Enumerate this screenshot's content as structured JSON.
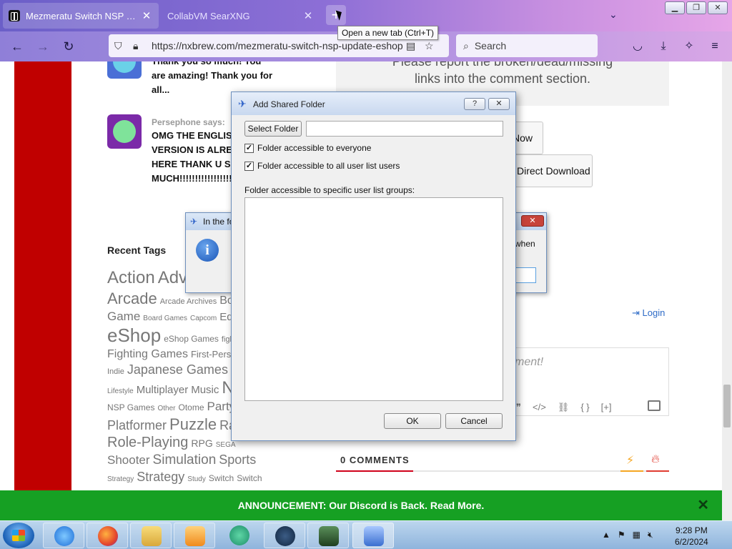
{
  "browser": {
    "tabs": [
      {
        "title": "Mezmeratu Switch NSP + Update",
        "active": true
      },
      {
        "title": "CollabVM SearXNG",
        "active": false
      }
    ],
    "new_tab_tooltip": "Open a new tab (Ctrl+T)",
    "url": "https://nxbrew.com/mezmeratu-switch-nsp-update-eshop",
    "search_placeholder": "Search"
  },
  "page": {
    "comments": [
      {
        "author": "",
        "text": "Thank you so much! You are amazing! Thank you for all..."
      },
      {
        "author": "Persephone says:",
        "text": "OMG THE ENGLISH VERSION IS ALREADY HERE THANK U SOOO MUCH!!!!!!!!!!!!!!!!!!!!!!!!!!!!!!..."
      }
    ],
    "report_text": "Please report the broken/dead/missing links into the comment section.",
    "download_now_label": "Now",
    "direct_download_label": "Direct Download",
    "recent_tags_title": "Recent Tags",
    "tag_lines": [
      [
        "Action",
        "Adv"
      ],
      [
        "Arcade",
        "Arcade Archives",
        "Boa"
      ],
      [
        "Game",
        "Board Games",
        "Capcom",
        "Educ"
      ],
      [
        "eShop",
        "eShop Games",
        "fightin"
      ],
      [
        "Fighting Games",
        "First-Person"
      ],
      [
        "Indie",
        "Japanese Games"
      ],
      [
        "Lifestyle",
        "Multiplayer",
        "Music",
        "N"
      ],
      [
        "NSP Games",
        "Other",
        "Otome",
        "Party"
      ],
      [
        "Platformer",
        "Puzzle",
        "Ra"
      ],
      [
        "Role-Playing",
        "RPG",
        "SEGA"
      ],
      [
        "Shooter",
        "Simulation",
        "Sports"
      ],
      [
        "Strategy",
        "Strategy",
        "Study",
        "Switch",
        "Switch"
      ]
    ],
    "login_label": "Login",
    "comment_placeholder": "ment!",
    "comments_count": "0 COMMENTS",
    "announcement": "ANNOUNCEMENT: Our Discord is Back. Read More."
  },
  "info_dialog": {
    "title": "In the fo",
    "message_fragment": "when"
  },
  "dialog": {
    "title": "Add Shared Folder",
    "help_label": "?",
    "select_folder_label": "Select Folder",
    "folder_value": "",
    "checkbox_everyone": {
      "label": "Folder accessible to everyone",
      "checked": true
    },
    "checkbox_all_users": {
      "label": "Folder accessible to all user list users",
      "checked": true
    },
    "groups_label": "Folder accessible to specific user list groups:",
    "ok_label": "OK",
    "cancel_label": "Cancel"
  },
  "taskbar": {
    "apps": [
      "internet-explorer",
      "firefox",
      "file-explorer",
      "media-player",
      "browser-app",
      "steam",
      "system-monitor",
      "shared-folder-app"
    ],
    "time": "9:28 PM",
    "date": "6/2/2024"
  },
  "colors": {
    "accent_red": "#c00000",
    "announcement_green": "#16a023",
    "link_blue": "#2f6cc7"
  }
}
